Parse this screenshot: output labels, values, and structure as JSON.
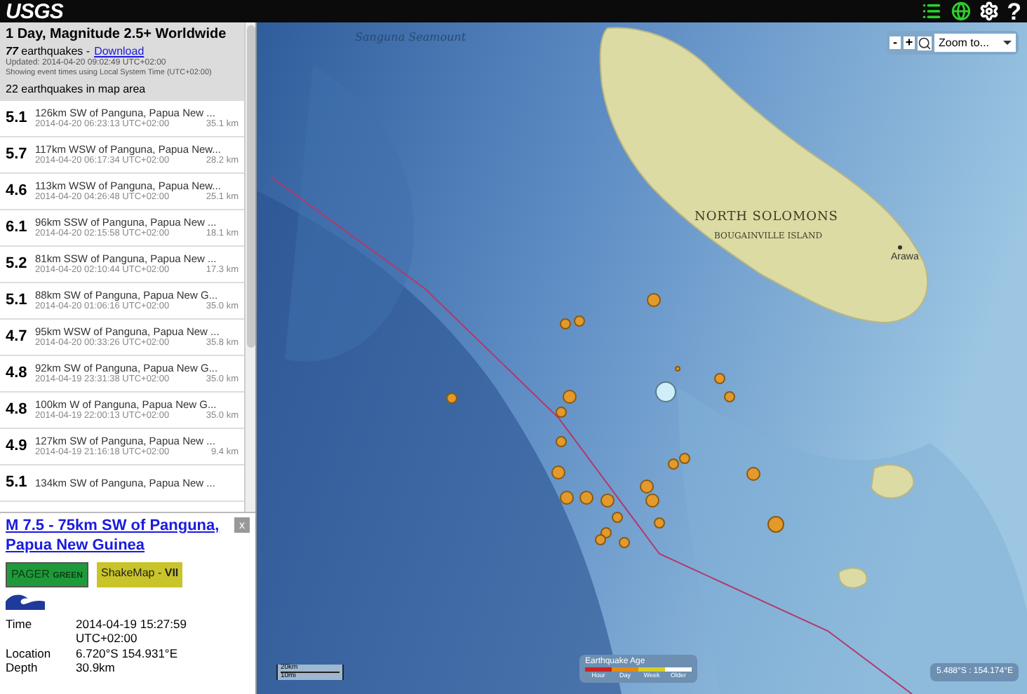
{
  "header": {
    "logo": "USGS",
    "help": "?"
  },
  "feed": {
    "title": "1 Day, Magnitude 2.5+ Worldwide",
    "count": "77",
    "count_label": "earthquakes -",
    "download": "Download",
    "updated": "Updated: 2014-04-20 09:02:49 UTC+02:00",
    "timezone_note": "Showing event times using Local System Time (UTC+02:00)",
    "map_count": "22 earthquakes in map area"
  },
  "events": [
    {
      "mag": "5.1",
      "title": "126km SW of Panguna, Papua New ...",
      "time": "2014-04-20 06:23:13 UTC+02:00",
      "depth": "35.1 km"
    },
    {
      "mag": "5.7",
      "title": "117km WSW of Panguna, Papua New...",
      "time": "2014-04-20 06:17:34 UTC+02:00",
      "depth": "28.2 km"
    },
    {
      "mag": "4.6",
      "title": "113km WSW of Panguna, Papua New...",
      "time": "2014-04-20 04:26:48 UTC+02:00",
      "depth": "25.1 km"
    },
    {
      "mag": "6.1",
      "title": "96km SSW of Panguna, Papua New ...",
      "time": "2014-04-20 02:15:58 UTC+02:00",
      "depth": "18.1 km"
    },
    {
      "mag": "5.2",
      "title": "81km SSW of Panguna, Papua New ...",
      "time": "2014-04-20 02:10:44 UTC+02:00",
      "depth": "17.3 km"
    },
    {
      "mag": "5.1",
      "title": "88km SW of Panguna, Papua New G...",
      "time": "2014-04-20 01:06:16 UTC+02:00",
      "depth": "35.0 km"
    },
    {
      "mag": "4.7",
      "title": "95km WSW of Panguna, Papua New ...",
      "time": "2014-04-20 00:33:26 UTC+02:00",
      "depth": "35.8 km"
    },
    {
      "mag": "4.8",
      "title": "92km SW of Panguna, Papua New G...",
      "time": "2014-04-19 23:31:38 UTC+02:00",
      "depth": "35.0 km"
    },
    {
      "mag": "4.8",
      "title": "100km W of Panguna, Papua New G...",
      "time": "2014-04-19 22:00:13 UTC+02:00",
      "depth": "35.0 km"
    },
    {
      "mag": "4.9",
      "title": "127km SW of Panguna, Papua New ...",
      "time": "2014-04-19 21:16:18 UTC+02:00",
      "depth": "9.4 km"
    },
    {
      "mag": "5.1",
      "title": "134km SW of Panguna, Papua New ..."
    }
  ],
  "detail": {
    "title": "M 7.5 - 75km SW of Panguna, Papua New Guinea",
    "close": "x",
    "pager": {
      "label": "PAGER",
      "level": "GREEN",
      "color": "#1f9a3a"
    },
    "shakemap": {
      "label": "ShakeMap -",
      "level": "VII",
      "color": "#c9c42a"
    },
    "tsunami": true,
    "fields": [
      {
        "label": "Time",
        "value": "2014-04-19 15:27:59 UTC+02:00"
      },
      {
        "label": "Location",
        "value": "6.720°S 154.931°E"
      },
      {
        "label": "Depth",
        "value": "30.9km"
      }
    ]
  },
  "map": {
    "zoom_out": "-",
    "zoom_in": "+",
    "zoom_select": "Zoom to...",
    "labels": [
      {
        "kind": "sea",
        "text": "Sanguna Seamount"
      },
      {
        "kind": "region",
        "text": "NORTH SOLOMONS"
      },
      {
        "kind": "island",
        "text": "BOUGAINVILLE ISLAND"
      },
      {
        "kind": "town",
        "text": "Arawa"
      }
    ],
    "scale": [
      "20km",
      "10mi"
    ],
    "legend": {
      "title": "Earthquake Age",
      "items": [
        {
          "label": "Hour",
          "color": "#cc2222"
        },
        {
          "label": "Day",
          "color": "#e38a12"
        },
        {
          "label": "Week",
          "color": "#d8cf22"
        },
        {
          "label": "Older",
          "color": "#ffffff"
        }
      ]
    },
    "coordinates": "5.488°S : 154.174°E"
  }
}
